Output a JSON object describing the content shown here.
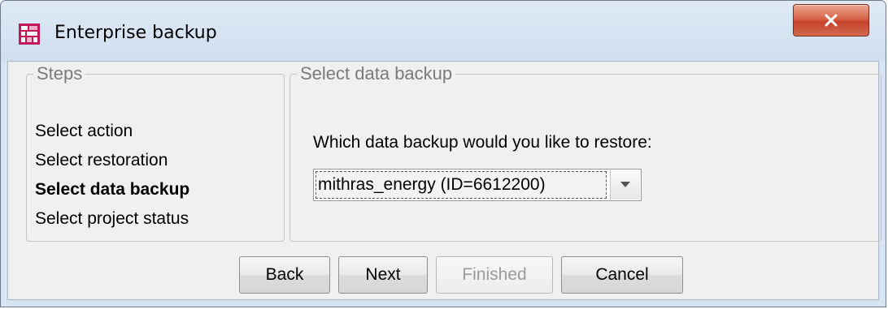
{
  "window": {
    "title": "Enterprise backup",
    "close_label": "X",
    "icon": "app-grid-icon"
  },
  "steps": {
    "legend": "Steps",
    "items": [
      {
        "label": "Select action",
        "current": false
      },
      {
        "label": "Select restoration",
        "current": false
      },
      {
        "label": "Select data backup",
        "current": true
      },
      {
        "label": "Select project status",
        "current": false
      }
    ]
  },
  "backup": {
    "legend": "Select data backup",
    "prompt": "Which data backup would you like to restore:",
    "selected": "mithras_energy (ID=6612200)"
  },
  "buttons": {
    "back": "Back",
    "next": "Next",
    "finished": "Finished",
    "cancel": "Cancel"
  },
  "colors": {
    "app_icon": "#c2185b",
    "close_button": "#c7432b",
    "titlebar": "#d7e4f2"
  }
}
